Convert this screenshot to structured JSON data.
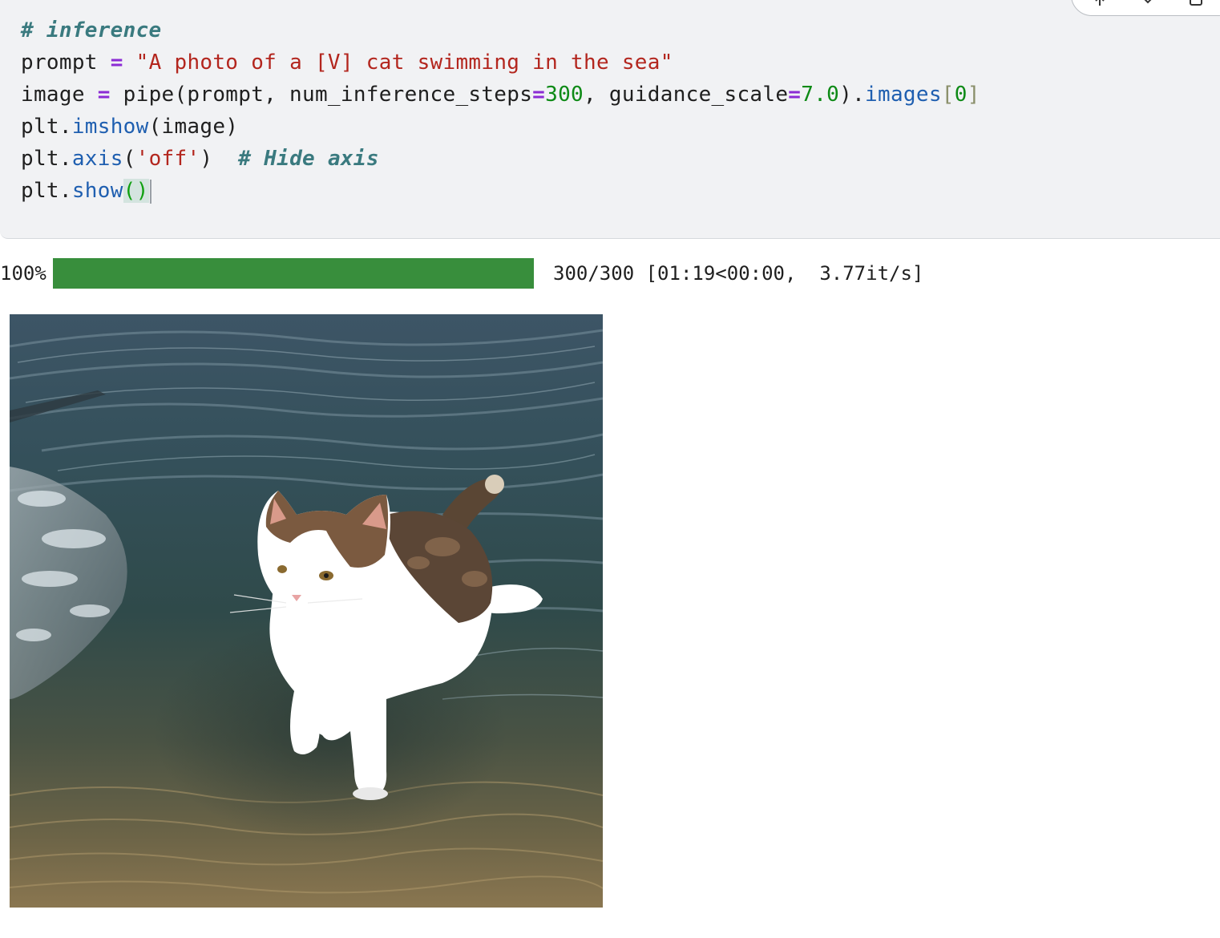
{
  "code_cell": {
    "lines": [
      [
        {
          "t": "comment",
          "v": "# inference"
        }
      ],
      [
        {
          "t": "plain",
          "v": "prompt "
        },
        {
          "t": "op",
          "v": "="
        },
        {
          "t": "plain",
          "v": " "
        },
        {
          "t": "string",
          "v": "\"A photo of a [V] cat swimming in the sea\""
        }
      ],
      [
        {
          "t": "plain",
          "v": "image "
        },
        {
          "t": "op",
          "v": "="
        },
        {
          "t": "plain",
          "v": " pipe(prompt, num_inference_steps"
        },
        {
          "t": "op",
          "v": "="
        },
        {
          "t": "num",
          "v": "300"
        },
        {
          "t": "plain",
          "v": ", guidance_scale"
        },
        {
          "t": "op",
          "v": "="
        },
        {
          "t": "num",
          "v": "7.0"
        },
        {
          "t": "plain",
          "v": ")."
        },
        {
          "t": "fn",
          "v": "images"
        },
        {
          "t": "brkt",
          "v": "["
        },
        {
          "t": "num",
          "v": "0"
        },
        {
          "t": "brkt",
          "v": "]"
        }
      ],
      [
        {
          "t": "plain",
          "v": "plt."
        },
        {
          "t": "fn",
          "v": "imshow"
        },
        {
          "t": "plain",
          "v": "(image)"
        }
      ],
      [
        {
          "t": "plain",
          "v": "plt."
        },
        {
          "t": "fn",
          "v": "axis"
        },
        {
          "t": "plain",
          "v": "("
        },
        {
          "t": "string",
          "v": "'off'"
        },
        {
          "t": "plain",
          "v": ")  "
        },
        {
          "t": "comment",
          "v": "# Hide axis"
        }
      ],
      [
        {
          "t": "plain",
          "v": "plt."
        },
        {
          "t": "fn",
          "v": "show"
        },
        {
          "t": "paren_hl",
          "v": "()"
        },
        {
          "t": "cursor",
          "v": ""
        }
      ]
    ],
    "toolbar_icons": [
      "arrow-up-icon",
      "arrow-down-icon",
      "copy-icon"
    ]
  },
  "output": {
    "progress": {
      "percent_label": "100%",
      "fraction": 1.0,
      "stats": "300/300 [01:19<00:00,  3.77it/s]",
      "bar_color": "#388e3c"
    },
    "image": {
      "icon": "cat-in-sea-image"
    }
  }
}
